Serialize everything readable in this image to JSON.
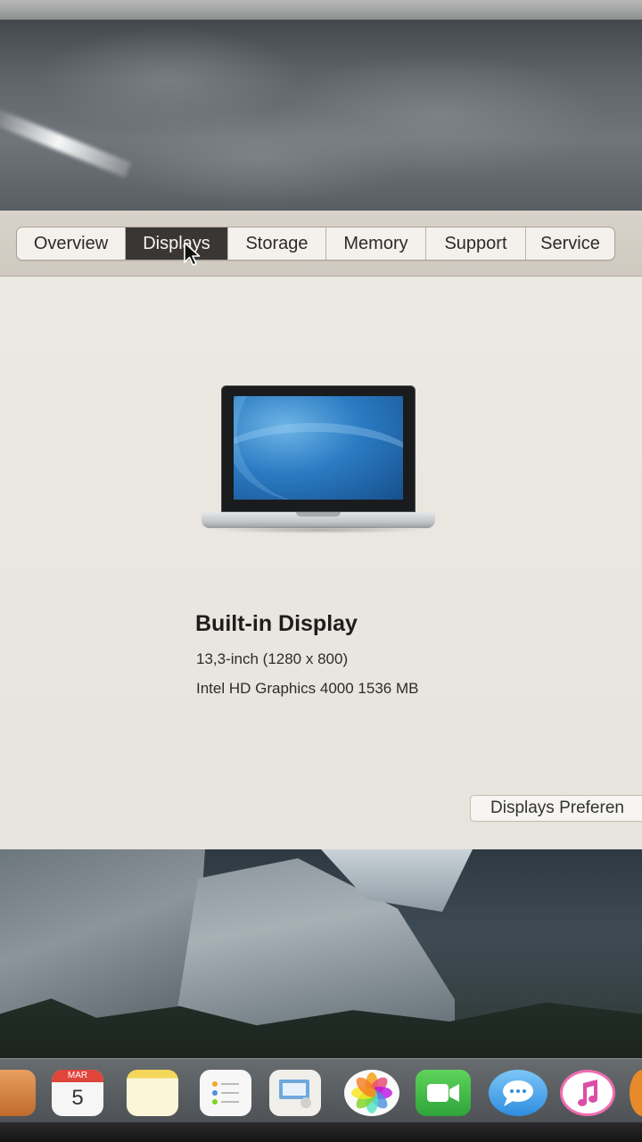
{
  "tabs": [
    {
      "label": "Overview",
      "active": false
    },
    {
      "label": "Displays",
      "active": true
    },
    {
      "label": "Storage",
      "active": false
    },
    {
      "label": "Memory",
      "active": false
    },
    {
      "label": "Support",
      "active": false
    },
    {
      "label": "Service",
      "active": false
    }
  ],
  "display": {
    "name": "Built-in Display",
    "size": "13,3-inch (1280 x 800)",
    "graphics": "Intel HD Graphics 4000 1536 MB"
  },
  "preferences_button": {
    "label": "Displays Preferen"
  },
  "calendar": {
    "month": "MAR",
    "day": "5"
  },
  "colors": {
    "active_tab": "#3a3634",
    "window_bg": "#e9e6df",
    "toolbar_bg": "#d3cdc5"
  }
}
